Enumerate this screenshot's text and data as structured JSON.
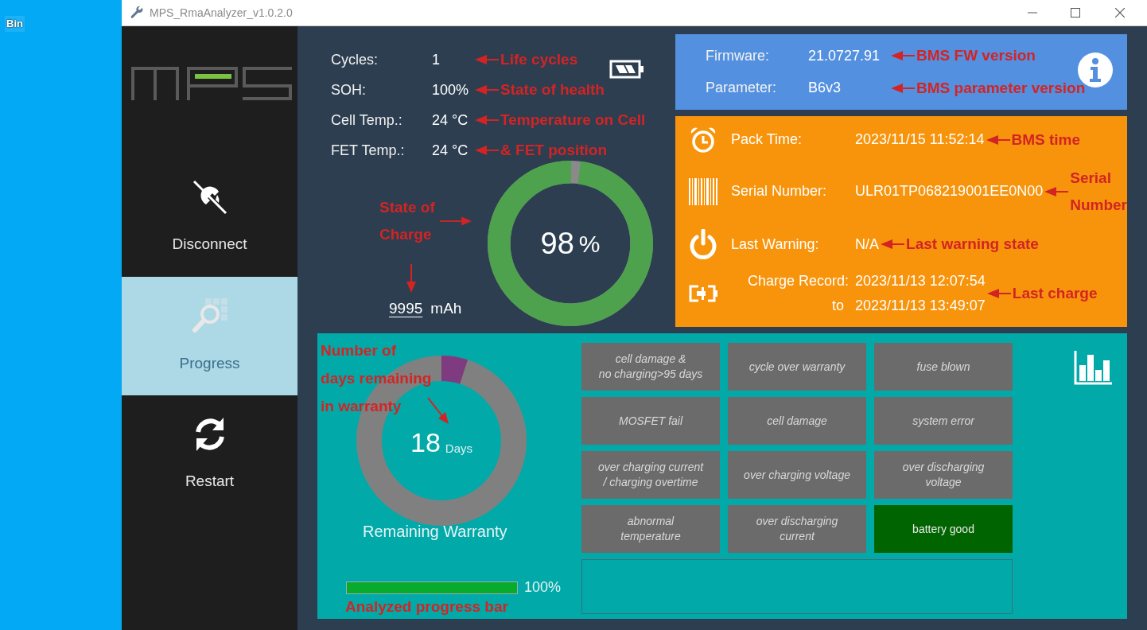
{
  "desktop": {
    "icon_label": "Bin"
  },
  "window": {
    "title": "MPS_RmaAnalyzer_v1.0.2.0"
  },
  "sidebar": {
    "items": [
      {
        "kind": "disconnect",
        "label": "Disconnect",
        "selected": false
      },
      {
        "kind": "progress",
        "label": "Progress",
        "selected": true
      },
      {
        "kind": "restart",
        "label": "Restart",
        "selected": false
      }
    ]
  },
  "stats": [
    {
      "label": "Cycles:",
      "value": "1",
      "note": "Life cycles"
    },
    {
      "label": "SOH:",
      "value": "100%",
      "note": "State of health"
    },
    {
      "label": "Cell Temp.:",
      "value": "24 °C",
      "note": "Temperature on Cell"
    },
    {
      "label": "FET Temp.:",
      "value": "24 °C",
      "note": "& FET position"
    }
  ],
  "charge": {
    "level": 0.98,
    "value": "98",
    "unit": "%",
    "capacity": "9995",
    "capacity_unit": "mAh",
    "note": "State of\nCharge"
  },
  "versions": [
    {
      "label": "Firmware:",
      "value": "21.0727.91",
      "note": "BMS FW version"
    },
    {
      "label": "Parameter:",
      "value": "B6v3",
      "note": "BMS parameter version"
    }
  ],
  "pack_info": [
    {
      "kind": "clock",
      "label": "Pack Time:",
      "values": [
        "2023/11/15 11:52:14"
      ],
      "note": "BMS time"
    },
    {
      "kind": "barcode",
      "label": "Serial Number:",
      "values": [
        "ULR01TP068219001EE0N00"
      ],
      "note": "Serial\nNumber"
    },
    {
      "kind": "power",
      "label": "Last Warning:",
      "values": [
        "N/A"
      ],
      "note": "Last warning state"
    },
    {
      "kind": "charge",
      "label": "Charge Record:",
      "values": [
        "2023/11/13 12:07:54",
        "2023/11/13 13:49:07"
      ],
      "joiner": "to",
      "note": "Last charge"
    }
  ],
  "warranty": {
    "level": 0.05,
    "days": "18",
    "unit": "Days",
    "caption": "Remaining Warranty",
    "note": "Number of\ndays remaining\nin warranty"
  },
  "analysis": {
    "level": 1,
    "reading": "100%",
    "note": "Analyzed progress bar"
  },
  "status_items": [
    {
      "label": "cell damage  &\nno charging>95 days",
      "active": false
    },
    {
      "label": "cycle over warranty",
      "active": false
    },
    {
      "label": "fuse blown",
      "active": false
    },
    {
      "label": "MOSFET fail",
      "active": false
    },
    {
      "label": "cell damage",
      "active": false
    },
    {
      "label": "system error",
      "active": false
    },
    {
      "label": "over charging current\n/ charging overtime",
      "active": false
    },
    {
      "label": "over charging voltage",
      "active": false
    },
    {
      "label": "over discharging\nvoltage",
      "active": false
    },
    {
      "label": "abnormal\ntemperature",
      "active": false
    },
    {
      "label": "over discharging\ncurrent",
      "active": false
    },
    {
      "label": "battery good",
      "active": true
    }
  ]
}
